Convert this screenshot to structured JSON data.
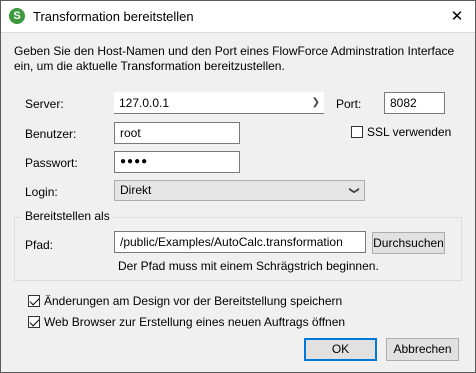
{
  "window": {
    "title": "Transformation bereitstellen",
    "close_glyph": "✕",
    "app_icon_letter": "S"
  },
  "intro_text": "Geben Sie den Host-Namen und den Port eines FlowForce Adminstration Interface ein, um die aktuelle Transformation bereitzustellen.",
  "server": {
    "label": "Server:",
    "value": "127.0.0.1"
  },
  "port": {
    "label": "Port:",
    "value": "8082"
  },
  "user": {
    "label": "Benutzer:",
    "value": "root"
  },
  "ssl": {
    "label": "SSL verwenden",
    "checked": false
  },
  "password": {
    "label": "Passwort:",
    "value": "●●●●"
  },
  "login": {
    "label": "Login:",
    "value": "Direkt"
  },
  "deploy_group": {
    "title": "Bereitstellen als",
    "path_label": "Pfad:",
    "path_value": "/public/Examples/AutoCalc.transformation",
    "browse_label": "Durchsuchen",
    "hint": "Der Pfad muss mit einem Schrägstrich beginnen."
  },
  "options": {
    "save_changes": {
      "label": "Änderungen am Design vor der Bereitstellung speichern",
      "checked": true
    },
    "open_browser": {
      "label": "Web Browser zur Erstellung eines neuen Auftrags öffnen",
      "checked": true
    }
  },
  "buttons": {
    "ok": "OK",
    "cancel": "Abbrechen"
  },
  "colors": {
    "app_icon": "#3c9a3c",
    "default_button_border": "#0078d7"
  }
}
